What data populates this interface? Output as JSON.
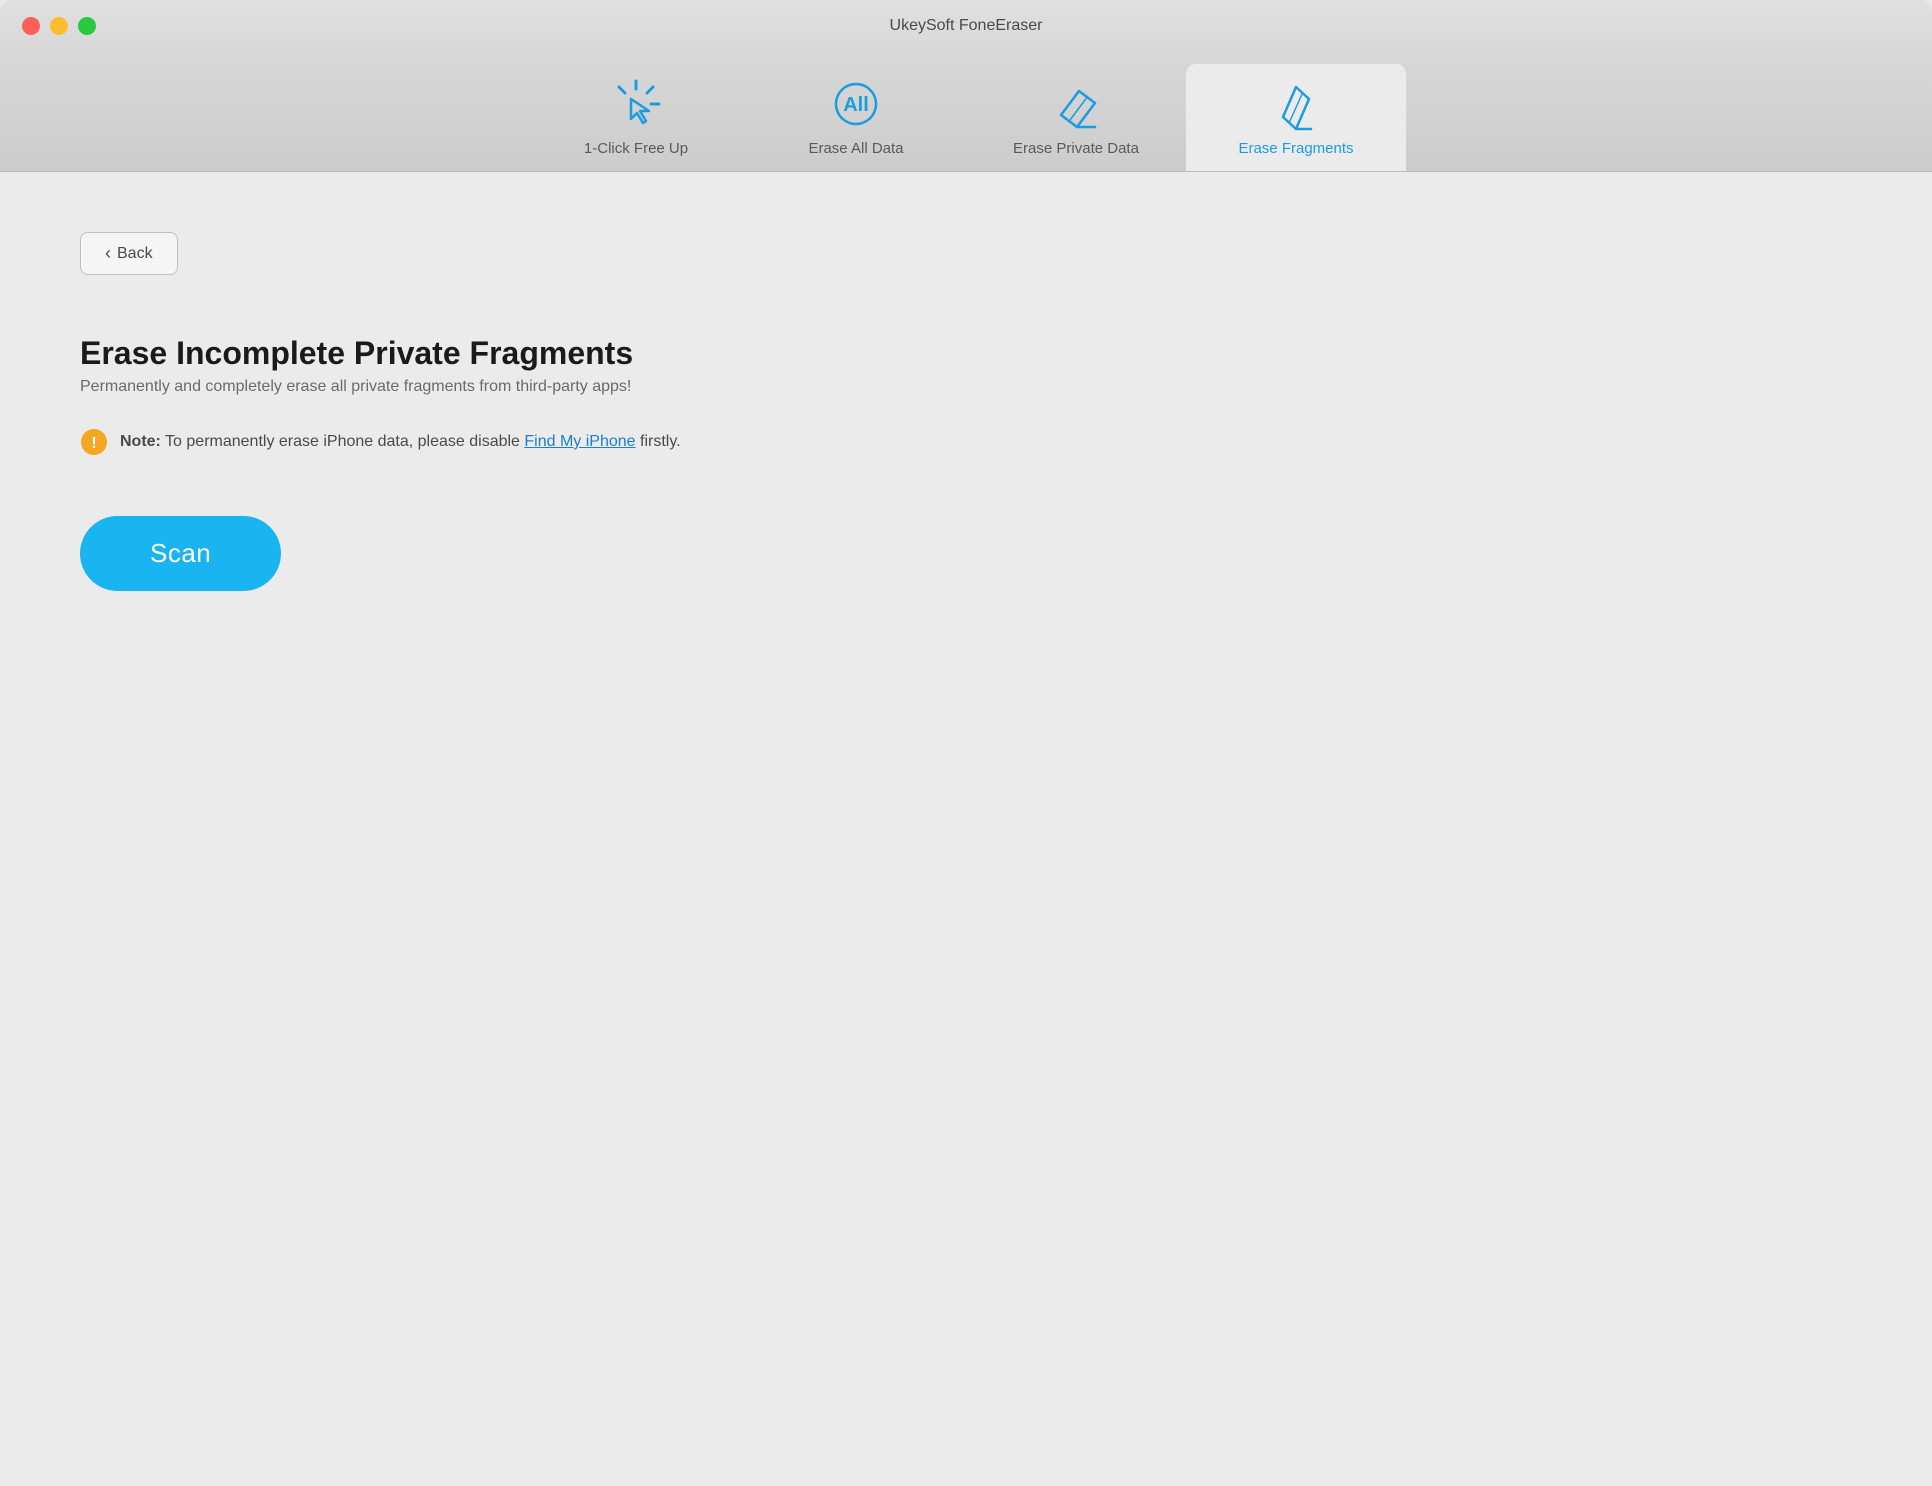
{
  "app": {
    "title": "UkeySoft FoneEraser"
  },
  "window_controls": {
    "close_label": "close",
    "minimize_label": "minimize",
    "maximize_label": "maximize"
  },
  "nav": {
    "tabs": [
      {
        "id": "one-click",
        "label": "1-Click Free Up",
        "active": false
      },
      {
        "id": "erase-all",
        "label": "Erase All Data",
        "active": false
      },
      {
        "id": "erase-private",
        "label": "Erase Private Data",
        "active": false
      },
      {
        "id": "erase-fragments",
        "label": "Erase Fragments",
        "active": true
      }
    ]
  },
  "back_button": {
    "label": "Back",
    "chevron": "‹"
  },
  "content": {
    "title": "Erase Incomplete Private Fragments",
    "subtitle": "Permanently and completely erase all private fragments from third-party apps!",
    "note_prefix": "Note:",
    "note_text": " To permanently erase iPhone data, please disable ",
    "note_link": "Find My iPhone",
    "note_suffix": " firstly."
  },
  "scan_button": {
    "label": "Scan"
  },
  "colors": {
    "blue": "#1a9de0",
    "warning_orange": "#f5a623",
    "text_dark": "#1a1a1a",
    "text_medium": "#6a6a6a",
    "text_light": "#4a4a4a",
    "link_blue": "#1a7fcc",
    "btn_bg": "#1ab4f0",
    "active_tab_bg": "#ebebeb"
  }
}
